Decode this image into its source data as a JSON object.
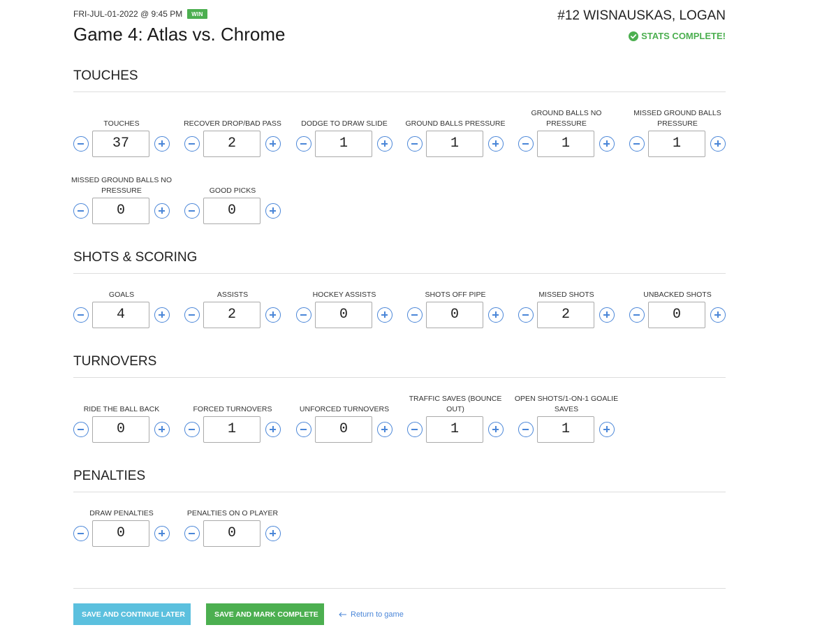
{
  "header": {
    "datetime": "FRI-JUL-01-2022 @ 9:45 PM",
    "result_badge": "WIN",
    "game_title": "Game 4: Atlas vs. Chrome",
    "player": "#12 WISNAUSKAS, LOGAN",
    "status": "STATS COMPLETE!"
  },
  "sections": [
    {
      "title": "TOUCHES",
      "stats": [
        {
          "label": "TOUCHES",
          "value": "37"
        },
        {
          "label": "RECOVER DROP/BAD PASS",
          "value": "2"
        },
        {
          "label": "DODGE TO DRAW SLIDE",
          "value": "1"
        },
        {
          "label": "GROUND BALLS PRESSURE",
          "value": "1"
        },
        {
          "label": "GROUND BALLS NO PRESSURE",
          "value": "1"
        },
        {
          "label": "MISSED GROUND BALLS PRESSURE",
          "value": "1"
        },
        {
          "label": "MISSED GROUND BALLS NO PRESSURE",
          "value": "0"
        },
        {
          "label": "GOOD PICKS",
          "value": "0"
        }
      ]
    },
    {
      "title": "SHOTS & SCORING",
      "stats": [
        {
          "label": "GOALS",
          "value": "4"
        },
        {
          "label": "ASSISTS",
          "value": "2"
        },
        {
          "label": "HOCKEY ASSISTS",
          "value": "0"
        },
        {
          "label": "SHOTS OFF PIPE",
          "value": "0"
        },
        {
          "label": "MISSED SHOTS",
          "value": "2"
        },
        {
          "label": "UNBACKED SHOTS",
          "value": "0"
        }
      ]
    },
    {
      "title": "TURNOVERS",
      "stats": [
        {
          "label": "RIDE THE BALL BACK",
          "value": "0"
        },
        {
          "label": "FORCED TURNOVERS",
          "value": "1"
        },
        {
          "label": "UNFORCED TURNOVERS",
          "value": "0"
        },
        {
          "label": "TRAFFIC SAVES (BOUNCE OUT)",
          "value": "1"
        },
        {
          "label": "OPEN SHOTS/1-ON-1 GOALIE SAVES",
          "value": "1"
        }
      ]
    },
    {
      "title": "PENALTIES",
      "stats": [
        {
          "label": "DRAW PENALTIES",
          "value": "0"
        },
        {
          "label": "PENALTIES ON O PLAYER",
          "value": "0"
        }
      ]
    }
  ],
  "footer": {
    "save_later_label": "SAVE AND CONTINUE LATER",
    "save_complete_label": "SAVE AND MARK COMPLETE",
    "return_label": "Return to game"
  },
  "colors": {
    "accent_blue": "#4a86d8",
    "success_green": "#4caf50",
    "info_blue": "#5bc0de"
  }
}
